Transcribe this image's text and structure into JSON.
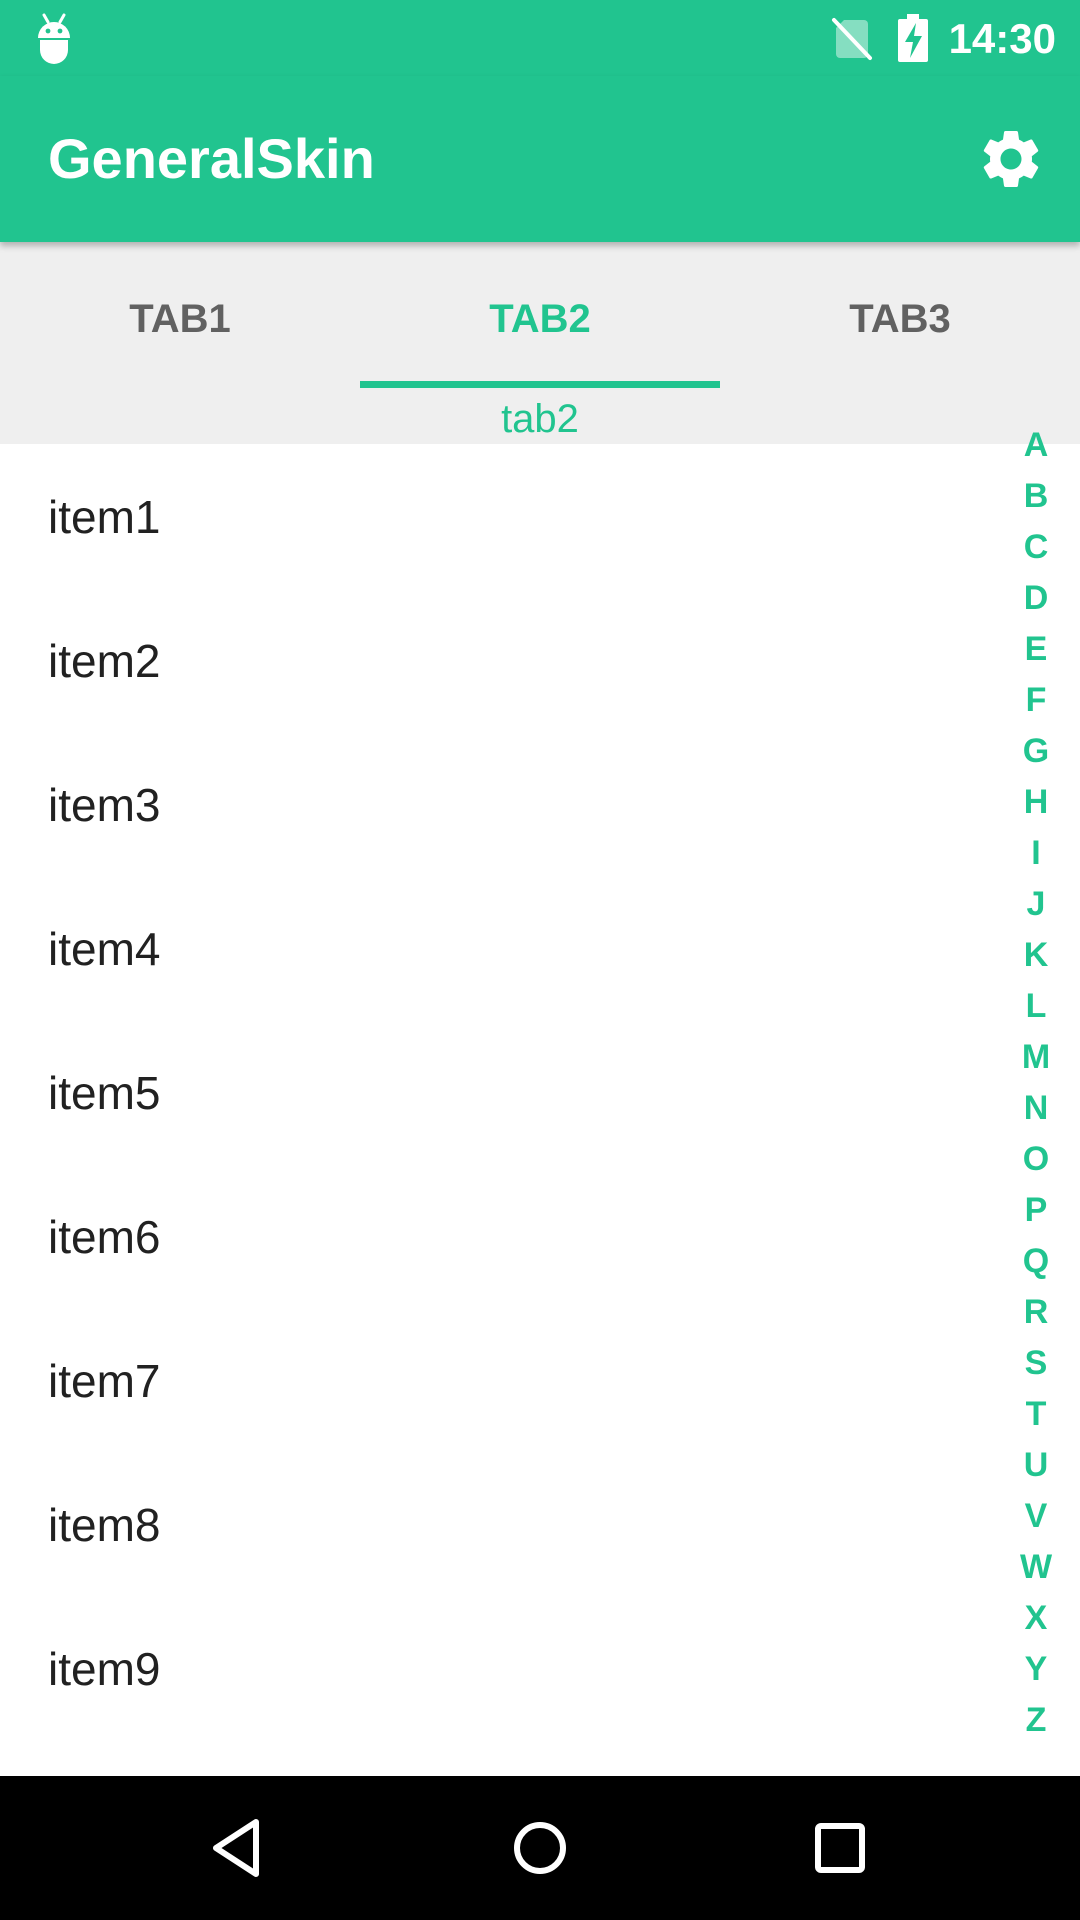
{
  "status_bar": {
    "time": "14:30",
    "icons": [
      "android-debug-icon",
      "no-sim-icon",
      "battery-charging-icon"
    ]
  },
  "app_bar": {
    "title": "GeneralSkin",
    "settings_icon": "gear-icon"
  },
  "tabs": {
    "items": [
      {
        "label": "TAB1"
      },
      {
        "label": "TAB2"
      },
      {
        "label": "TAB3"
      }
    ],
    "selected": "TAB2",
    "content_label": "tab2"
  },
  "list": {
    "items": [
      "item1",
      "item2",
      "item3",
      "item4",
      "item5",
      "item6",
      "item7",
      "item8",
      "item9"
    ]
  },
  "index_bar": {
    "letters": [
      "A",
      "B",
      "C",
      "D",
      "E",
      "F",
      "G",
      "H",
      "I",
      "J",
      "K",
      "L",
      "M",
      "N",
      "O",
      "P",
      "Q",
      "R",
      "S",
      "T",
      "U",
      "V",
      "W",
      "X",
      "Y",
      "Z"
    ]
  },
  "nav_bar": {
    "icons": [
      "back-icon",
      "home-icon",
      "recent-apps-icon"
    ]
  },
  "colors": {
    "accent": "#21c48f",
    "tab_background": "#efefef",
    "inactive_tab_text": "#616161",
    "item_text": "#212121"
  }
}
